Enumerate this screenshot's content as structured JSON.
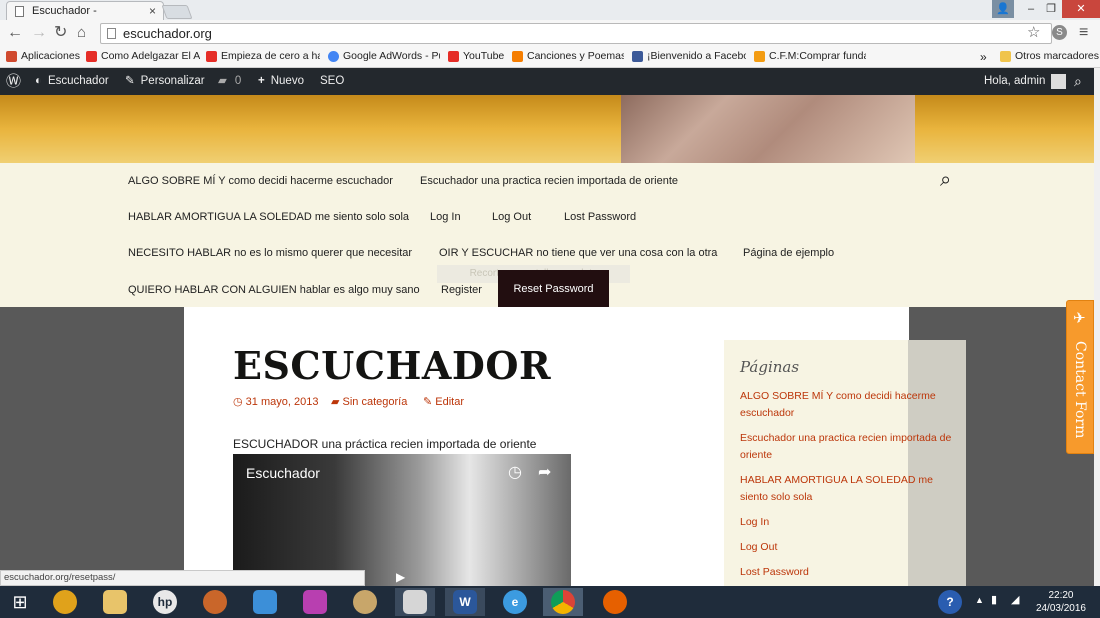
{
  "browser": {
    "tab_title": "Escuchador -",
    "tab_close": "×",
    "url": "escuchador.org",
    "win_min": "–",
    "win_max": "❐",
    "win_close": "✕",
    "bookmarks": [
      {
        "label": "Aplicaciones",
        "color": "#d04a2f"
      },
      {
        "label": "Como Adelgazar El Al",
        "color": "#e52d27"
      },
      {
        "label": "Empieza de cero a ha",
        "color": "#e52d27"
      },
      {
        "label": "Google AdWords - Pu",
        "color": "#4285f4"
      },
      {
        "label": "YouTube",
        "color": "#e52d27"
      },
      {
        "label": "Canciones y Poemas:",
        "color": "#f57d00"
      },
      {
        "label": "¡Bienvenido a Facebo",
        "color": "#3b5998"
      },
      {
        "label": "C.F.M:Comprar funda",
        "color": "#f39c12"
      }
    ],
    "bookmarks_more": "»",
    "other_bookmarks": "Otros marcadores"
  },
  "wpbar": {
    "site": "Escuchador",
    "customize": "Personalizar",
    "comments": "0",
    "new": "Nuevo",
    "seo": "SEO",
    "greeting": "Hola, admin"
  },
  "menu": {
    "row1": [
      "ALGO SOBRE MÍ Y como decidi hacerme escuchador",
      "Escuchador una practica recien importada de oriente"
    ],
    "row2": [
      "HABLAR AMORTIGUA LA SOLEDAD me siento solo sola",
      "Log In",
      "Log Out",
      "Lost Password"
    ],
    "row3": [
      "NECESITO HABLAR no es lo mismo querer que necesitar",
      "OIR Y ESCUCHAR no tiene que ver una cosa con la otra",
      "Página de ejemplo"
    ],
    "row4": [
      "QUIERO HABLAR CON ALGUIEN hablar es algo muy sano",
      "Register"
    ],
    "active": "Reset Password",
    "tooltip": "Recortar a pantalla completa"
  },
  "post": {
    "title": "ESCUCHADOR",
    "date": "31 mayo, 2013",
    "category": "Sin categoría",
    "edit": "Editar",
    "excerpt": "ESCUCHADOR una práctica recien importada de oriente",
    "video_title": "Escuchador"
  },
  "sidebar": {
    "title": "Páginas",
    "links": [
      "ALGO SOBRE MÍ Y como decidi hacerme escuchador",
      "Escuchador una practica recien importada de oriente",
      "HABLAR AMORTIGUA LA SOLEDAD me siento solo sola",
      "Log In",
      "Log Out",
      "Lost Password"
    ]
  },
  "contact_form": "Contact Form",
  "status_url": "escuchador.org/resetpass/",
  "clock": {
    "time": "22:20",
    "date": "24/03/2016"
  }
}
